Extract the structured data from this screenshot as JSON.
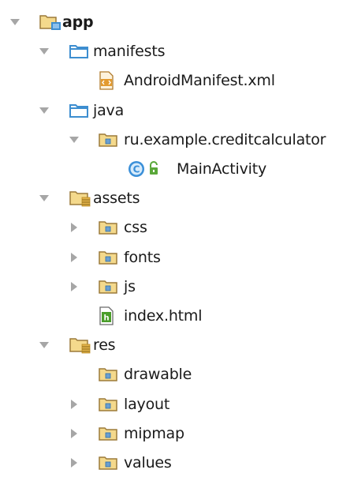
{
  "colors": {
    "arrow": "#a6a6a6",
    "folder_outline": "#9b7a3a",
    "folder_fill": "#f4d98c",
    "folder_blue": "#3d8ed0",
    "package_dot": "#6a9fd0",
    "resource_bars": "#e2b24a",
    "class_badge": "#3a8fd8",
    "lock_green": "#5aa83a"
  },
  "tree": {
    "items": [
      {
        "label": "app",
        "bold": true,
        "depth": 0,
        "arrow": "expanded",
        "icon": "module-folder-icon"
      },
      {
        "label": "manifests",
        "depth": 1,
        "arrow": "expanded",
        "icon": "folder-blue-icon"
      },
      {
        "label": "AndroidManifest.xml",
        "depth": 2,
        "arrow": "none",
        "icon": "xml-file-icon"
      },
      {
        "label": "java",
        "depth": 1,
        "arrow": "expanded",
        "icon": "folder-blue-icon"
      },
      {
        "label": "ru.example.creditcalculator",
        "depth": 2,
        "arrow": "expanded",
        "icon": "package-folder-icon"
      },
      {
        "label": "MainActivity",
        "depth": 3,
        "arrow": "none",
        "icon": "class-icon"
      },
      {
        "label": "assets",
        "depth": 1,
        "arrow": "expanded",
        "icon": "resource-folder-icon"
      },
      {
        "label": "css",
        "depth": 2,
        "arrow": "collapsed",
        "icon": "package-folder-icon"
      },
      {
        "label": "fonts",
        "depth": 2,
        "arrow": "collapsed",
        "icon": "package-folder-icon"
      },
      {
        "label": "js",
        "depth": 2,
        "arrow": "collapsed",
        "icon": "package-folder-icon"
      },
      {
        "label": "index.html",
        "depth": 2,
        "arrow": "none",
        "icon": "html-file-icon"
      },
      {
        "label": "res",
        "depth": 1,
        "arrow": "expanded",
        "icon": "resource-folder-icon"
      },
      {
        "label": "drawable",
        "depth": 2,
        "arrow": "none",
        "icon": "package-folder-icon"
      },
      {
        "label": "layout",
        "depth": 2,
        "arrow": "collapsed",
        "icon": "package-folder-icon"
      },
      {
        "label": "mipmap",
        "depth": 2,
        "arrow": "collapsed",
        "icon": "package-folder-icon"
      },
      {
        "label": "values",
        "depth": 2,
        "arrow": "collapsed",
        "icon": "package-folder-icon"
      }
    ]
  }
}
